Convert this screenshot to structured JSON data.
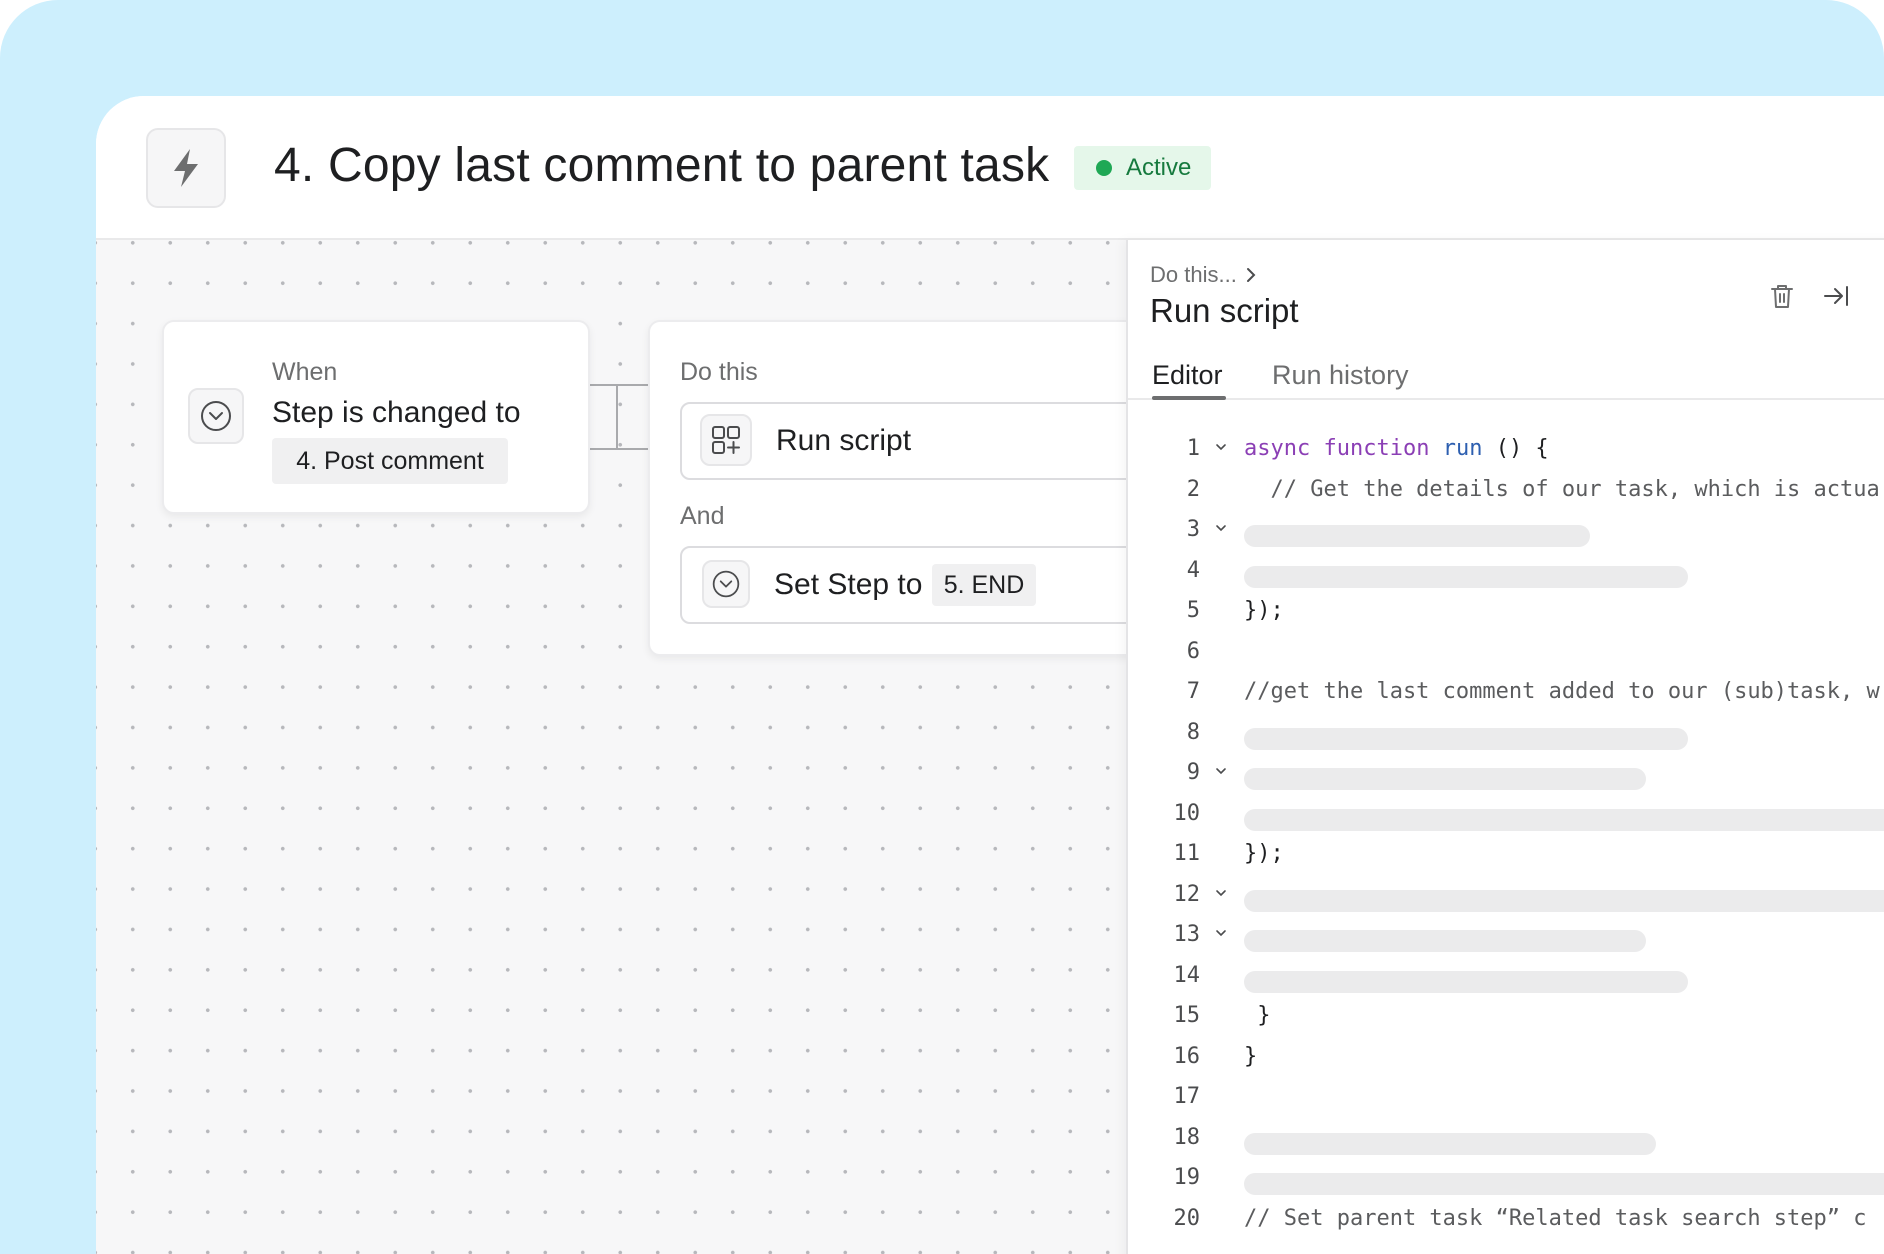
{
  "header": {
    "title": "4. Copy last comment to parent task",
    "status": "Active",
    "icon": "bolt-icon",
    "colors": {
      "status_bg": "#e5f7ea",
      "status_dot": "#1fa855",
      "status_text": "#167a3e"
    }
  },
  "canvas": {
    "trigger": {
      "section_label": "When",
      "title": "Step is changed to",
      "chip": "4. Post comment",
      "icon": "chevron-circle-icon"
    },
    "actions": {
      "section_label": "Do this",
      "items": [
        {
          "label": "Run script",
          "icon": "apps-add-icon"
        }
      ],
      "and_label": "And",
      "secondary": {
        "label": "Set Step to",
        "chip": "5. END",
        "icon": "chevron-circle-icon"
      }
    }
  },
  "panel": {
    "breadcrumb": "Do this...",
    "title": "Run script",
    "actions": [
      "trash-icon",
      "collapse-right-icon"
    ],
    "tabs": [
      {
        "label": "Editor",
        "active": true
      },
      {
        "label": "Run history",
        "active": false
      }
    ],
    "code": {
      "line1": {
        "kw1": "async",
        "kw2": "function",
        "fn": "run",
        "rest": " () {"
      },
      "line2": "  // Get the details of our task, which is actua",
      "line5": "});",
      "line7": "//get the last comment added to our (sub)task, w",
      "line11": "});",
      "line15": " }",
      "line16": "}",
      "line20": "// Set parent task “Related task search step” c",
      "line_numbers": [
        "1",
        "2",
        "3",
        "4",
        "5",
        "6",
        "7",
        "8",
        "9",
        "10",
        "11",
        "12",
        "13",
        "14",
        "15",
        "16",
        "17",
        "18",
        "19",
        "20"
      ]
    }
  }
}
